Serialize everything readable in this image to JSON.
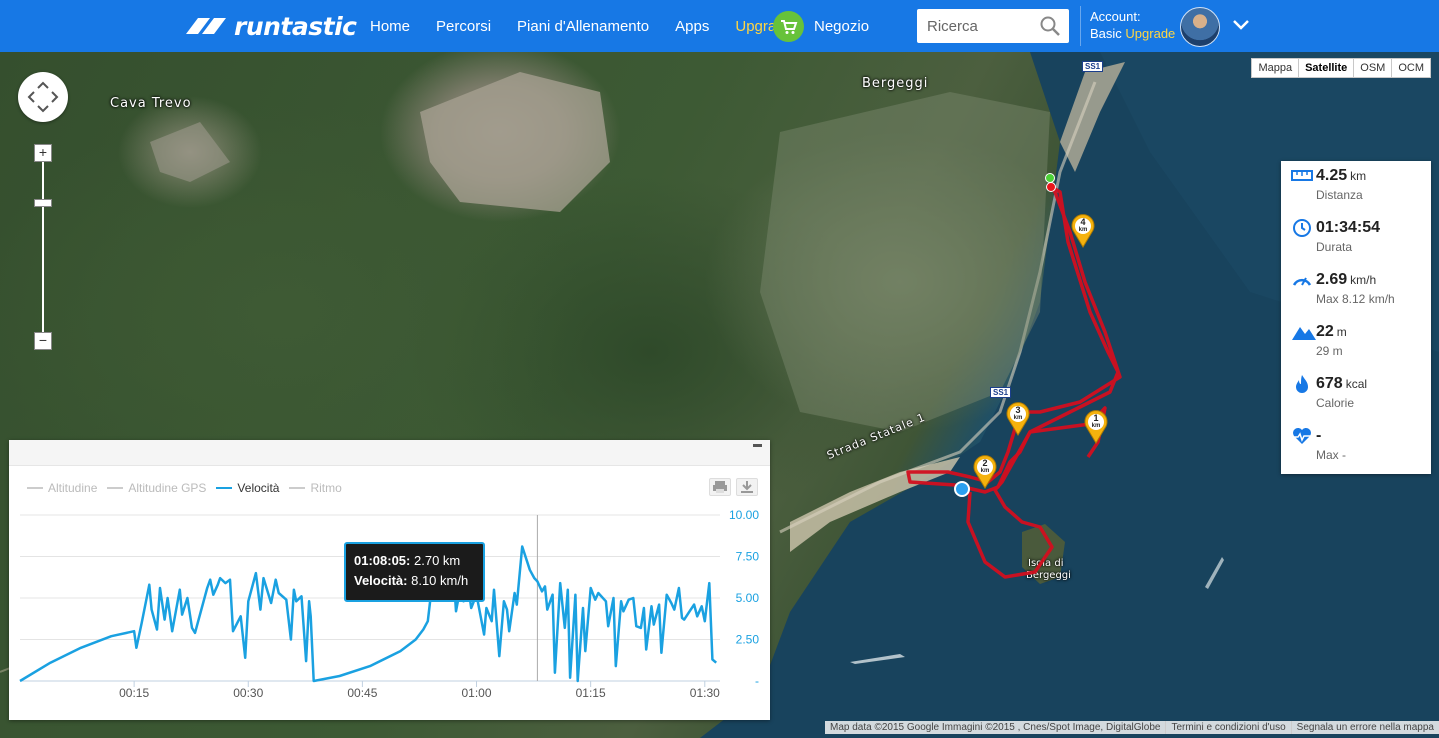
{
  "header": {
    "logo_text": "runtastic",
    "nav": [
      {
        "label": "Home"
      },
      {
        "label": "Percorsi"
      },
      {
        "label": "Piani d'Allenamento"
      },
      {
        "label": "Apps"
      },
      {
        "label": "Upgrade"
      }
    ],
    "shop_label": "Negozio",
    "search_placeholder": "Ricerca",
    "account_label": "Account:",
    "account_plan": "Basic",
    "account_upgrade": "Upgrade"
  },
  "map": {
    "types": [
      "Mappa",
      "Satellite",
      "OSM",
      "OCM"
    ],
    "active_type": "Satellite",
    "labels": {
      "cava": "Cava Trevo",
      "bergeggi": "Bergeggi",
      "strada": "Strada Statale 1",
      "isola_1": "Isola di",
      "isola_2": "Bergeggi",
      "ss1_top": "SS1",
      "ss1_mid": "SS1"
    },
    "km_markers": [
      "1",
      "2",
      "3",
      "4"
    ],
    "km_unit": "km",
    "footer": [
      "Map data ©2015 Google Immagini ©2015 , Cnes/Spot Image, DigitalGlobe",
      "Termini e condizioni d'uso",
      "Segnala un errore nella mappa"
    ]
  },
  "stats": [
    {
      "icon": "ruler-icon",
      "value": "4.25",
      "unit": "km",
      "label": "Distanza"
    },
    {
      "icon": "clock-icon",
      "value": "01:34:54",
      "unit": "",
      "label": "Durata"
    },
    {
      "icon": "speedometer-icon",
      "value": "2.69",
      "unit": "km/h",
      "label": "Max 8.12 km/h"
    },
    {
      "icon": "mountain-icon",
      "value": "22",
      "unit": "m",
      "label": "29 m"
    },
    {
      "icon": "flame-icon",
      "value": "678",
      "unit": "kcal",
      "label": "Calorie"
    },
    {
      "icon": "heart-rate-icon",
      "value": "-",
      "unit": "",
      "label": "Max -"
    }
  ],
  "chart_data": {
    "type": "line",
    "legend": [
      {
        "name": "Altitudine",
        "active": false
      },
      {
        "name": "Altitudine GPS",
        "active": false
      },
      {
        "name": "Velocità",
        "active": true
      },
      {
        "name": "Ritmo",
        "active": false
      }
    ],
    "x_tick_labels": [
      "00:15",
      "00:30",
      "00:45",
      "01:00",
      "01:15",
      "01:30"
    ],
    "x_tick_minutes": [
      15,
      30,
      45,
      60,
      75,
      90
    ],
    "xlim_minutes": [
      0,
      92
    ],
    "y_tick_labels": [
      "10.00",
      "7.50",
      "5.00",
      "2.50",
      "-"
    ],
    "ylim": [
      0,
      10
    ],
    "series": [
      {
        "name": "Velocità",
        "unit": "km/h",
        "x_minutes": [
          0,
          4,
          8,
          12,
          15,
          15.3,
          16,
          17,
          17.3,
          18,
          18.4,
          19,
          19.4,
          20,
          21,
          21.3,
          22,
          22.6,
          23,
          24.6,
          25,
          25.4,
          26,
          26.3,
          27,
          27.6,
          28,
          29,
          29.6,
          30,
          31,
          31.6,
          32,
          33,
          33.6,
          34,
          35,
          35.6,
          36,
          36.3,
          37,
          37.6,
          38,
          38.2,
          38.6,
          42,
          46,
          50,
          52,
          53,
          53.6,
          54,
          55,
          55.6,
          56,
          56.3,
          57,
          57.3,
          58,
          58.3,
          59,
          59.3,
          60,
          61,
          61.3,
          62,
          62.3,
          63,
          63.6,
          64,
          64.3,
          65,
          65.3,
          66,
          67,
          67.6,
          68,
          68.6,
          69,
          69.3,
          70,
          70.3,
          71,
          71.6,
          72,
          72.3,
          73,
          73.3,
          74,
          74.3,
          75,
          75.6,
          76,
          77,
          77.3,
          78,
          78.3,
          79,
          79.3,
          80,
          80.6,
          81,
          81.6,
          82,
          82.3,
          83,
          83.3,
          84,
          84.3,
          85,
          85.6,
          86,
          86.6,
          87,
          87.3,
          88,
          88.6,
          89,
          89.6,
          90,
          90.6,
          91,
          91.5
        ],
        "values": [
          0,
          1.1,
          2.0,
          2.7,
          3.0,
          2.0,
          3.5,
          5.8,
          4.3,
          3.1,
          5.6,
          3.7,
          5.0,
          3.0,
          5.5,
          4.0,
          5.0,
          3.2,
          2.9,
          5.6,
          6.1,
          5.2,
          5.8,
          6.2,
          5.9,
          6.1,
          3.0,
          3.9,
          1.4,
          4.8,
          6.5,
          4.3,
          6.2,
          4.7,
          6.1,
          5.3,
          4.9,
          2.5,
          5.5,
          4.8,
          5.1,
          1.2,
          4.8,
          3.9,
          0,
          0.3,
          0.9,
          1.8,
          2.5,
          3.1,
          3.6,
          5.2,
          4.9,
          6.4,
          5.1,
          5.8,
          6.3,
          4.2,
          5.9,
          4.8,
          5.4,
          4.4,
          5.2,
          2.8,
          4.4,
          3.6,
          5.5,
          1.5,
          4.8,
          4.3,
          3.0,
          5.3,
          4.6,
          8.1,
          6.7,
          6.2,
          6.0,
          5.4,
          5.7,
          4.3,
          5.2,
          0.5,
          5.9,
          3.2,
          5.5,
          0.2,
          5.2,
          0,
          4.4,
          1.8,
          5.6,
          4.9,
          5.3,
          4.8,
          3.3,
          5.0,
          0.9,
          4.8,
          4.2,
          4.9,
          5.0,
          3.3,
          3.2,
          4.4,
          1.9,
          4.5,
          3.4,
          4.6,
          1.7,
          5.2,
          4.7,
          4.3,
          5.6,
          3.8,
          3.7,
          4.2,
          4.6,
          3.9,
          4.5,
          3.6,
          5.9,
          1.3,
          1.1
        ]
      }
    ],
    "cursor_minute": 68,
    "tooltip": {
      "time": "01:08:05",
      "distance": "2.70 km",
      "speed_label": "Velocità",
      "speed_value": "8.10 km/h"
    }
  }
}
